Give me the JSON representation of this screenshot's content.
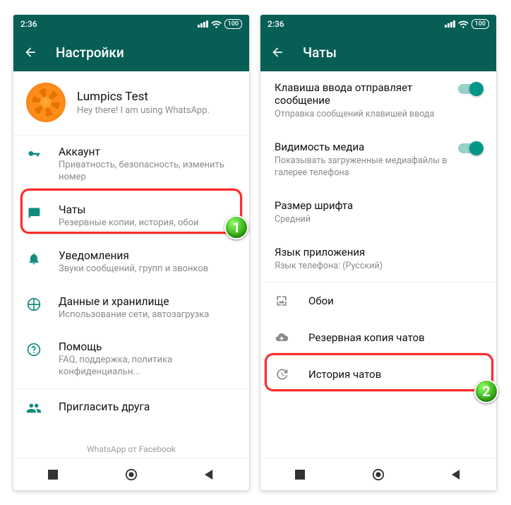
{
  "statusbar": {
    "time": "2:36",
    "battery": "100"
  },
  "left": {
    "title": "Настройки",
    "profile": {
      "name": "Lumpics Test",
      "status": "Hey there! I am using WhatsApp."
    },
    "rows": [
      {
        "icon": "key-icon",
        "primary": "Аккаунт",
        "secondary": "Приватность, безопасность, изменить номер"
      },
      {
        "icon": "chat-icon",
        "primary": "Чаты",
        "secondary": "Резервные копии, история, обои"
      },
      {
        "icon": "bell-icon",
        "primary": "Уведомления",
        "secondary": "Звуки сообщений, групп и звонков"
      },
      {
        "icon": "data-icon",
        "primary": "Данные и хранилище",
        "secondary": "Использование сети, автозагрузка"
      },
      {
        "icon": "help-icon",
        "primary": "Помощь",
        "secondary": "FAQ, поддержка, политика конфиденциальн..."
      },
      {
        "icon": "people-icon",
        "primary": "Пригласить друга",
        "secondary": ""
      }
    ],
    "footer": "WhatsApp от Facebook"
  },
  "right": {
    "title": "Чаты",
    "settings": [
      {
        "primary": "Клавиша ввода отправляет сообщение",
        "secondary": "Отправка сообщений клавишей ввода",
        "toggle": true
      },
      {
        "primary": "Видимость медиа",
        "secondary": "Показывать загруженные медиафайлы в галерее телефона",
        "toggle": true
      },
      {
        "primary": "Размер шрифта",
        "secondary": "Средний",
        "toggle": false
      },
      {
        "primary": "Язык приложения",
        "secondary": "Язык телефона: (Русский)",
        "toggle": false
      }
    ],
    "iconrows": [
      {
        "icon": "wallpaper-icon",
        "label": "Обои"
      },
      {
        "icon": "cloud-up-icon",
        "label": "Резервная копия чатов"
      },
      {
        "icon": "history-icon",
        "label": "История чатов"
      }
    ]
  },
  "badges": {
    "one": "1",
    "two": "2"
  }
}
